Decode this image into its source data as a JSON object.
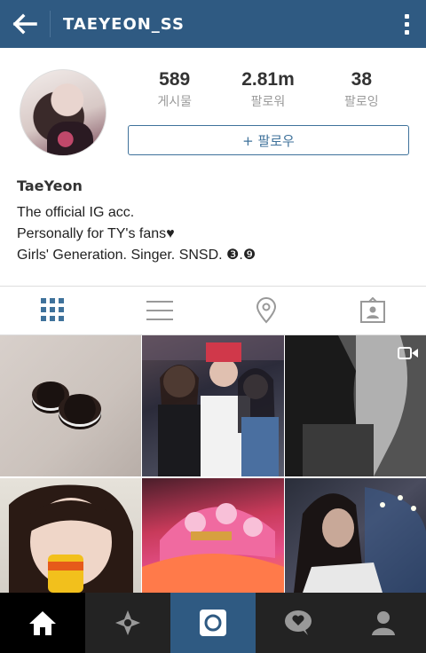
{
  "header": {
    "username": "TAEYEON_SS",
    "colors": {
      "bar": "#2f5a82",
      "text": "#ffffff"
    },
    "icons": {
      "back": "arrow-left-icon",
      "more": "vertical-dots-icon"
    }
  },
  "profile": {
    "stats": [
      {
        "value": "589",
        "label": "게시물"
      },
      {
        "value": "2.81m",
        "label": "팔로워"
      },
      {
        "value": "38",
        "label": "팔로잉"
      }
    ],
    "follow_label": "+ 팔로우",
    "name": "TaeYeon",
    "bio_lines": [
      "The official IG acc.",
      "Personally for TY's fans♥",
      "Girls' Generation. Singer. SNSD. ❸.❾"
    ]
  },
  "tabs": [
    {
      "icon": "grid-icon",
      "active": true
    },
    {
      "icon": "list-icon",
      "active": false
    },
    {
      "icon": "location-pin-icon",
      "active": false
    },
    {
      "icon": "tagged-photo-icon",
      "active": false
    }
  ],
  "photos": [
    {
      "icon": "photo-oreo"
    },
    {
      "icon": "photo-group"
    },
    {
      "icon": "photo-video",
      "badge": "video-camera-icon"
    },
    {
      "icon": "photo-drink"
    },
    {
      "icon": "photo-cap"
    },
    {
      "icon": "photo-stadium"
    }
  ],
  "bottom_nav": [
    {
      "icon": "home-icon",
      "active": true
    },
    {
      "icon": "explore-icon",
      "active": false
    },
    {
      "icon": "camera-icon",
      "active": false
    },
    {
      "icon": "activity-icon",
      "active": false
    },
    {
      "icon": "profile-icon",
      "active": false
    }
  ],
  "accent_color": "#3f729b"
}
